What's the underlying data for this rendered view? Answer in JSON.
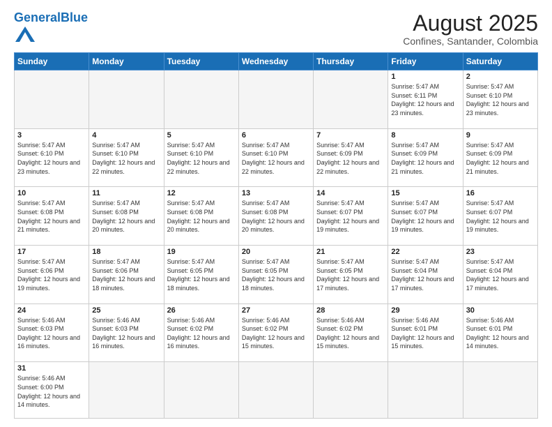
{
  "header": {
    "logo_general": "General",
    "logo_blue": "Blue",
    "month_title": "August 2025",
    "location": "Confines, Santander, Colombia"
  },
  "weekdays": [
    "Sunday",
    "Monday",
    "Tuesday",
    "Wednesday",
    "Thursday",
    "Friday",
    "Saturday"
  ],
  "weeks": [
    [
      {
        "day": "",
        "info": ""
      },
      {
        "day": "",
        "info": ""
      },
      {
        "day": "",
        "info": ""
      },
      {
        "day": "",
        "info": ""
      },
      {
        "day": "",
        "info": ""
      },
      {
        "day": "1",
        "info": "Sunrise: 5:47 AM\nSunset: 6:11 PM\nDaylight: 12 hours and 23 minutes."
      },
      {
        "day": "2",
        "info": "Sunrise: 5:47 AM\nSunset: 6:10 PM\nDaylight: 12 hours and 23 minutes."
      }
    ],
    [
      {
        "day": "3",
        "info": "Sunrise: 5:47 AM\nSunset: 6:10 PM\nDaylight: 12 hours and 23 minutes."
      },
      {
        "day": "4",
        "info": "Sunrise: 5:47 AM\nSunset: 6:10 PM\nDaylight: 12 hours and 22 minutes."
      },
      {
        "day": "5",
        "info": "Sunrise: 5:47 AM\nSunset: 6:10 PM\nDaylight: 12 hours and 22 minutes."
      },
      {
        "day": "6",
        "info": "Sunrise: 5:47 AM\nSunset: 6:10 PM\nDaylight: 12 hours and 22 minutes."
      },
      {
        "day": "7",
        "info": "Sunrise: 5:47 AM\nSunset: 6:09 PM\nDaylight: 12 hours and 22 minutes."
      },
      {
        "day": "8",
        "info": "Sunrise: 5:47 AM\nSunset: 6:09 PM\nDaylight: 12 hours and 21 minutes."
      },
      {
        "day": "9",
        "info": "Sunrise: 5:47 AM\nSunset: 6:09 PM\nDaylight: 12 hours and 21 minutes."
      }
    ],
    [
      {
        "day": "10",
        "info": "Sunrise: 5:47 AM\nSunset: 6:08 PM\nDaylight: 12 hours and 21 minutes."
      },
      {
        "day": "11",
        "info": "Sunrise: 5:47 AM\nSunset: 6:08 PM\nDaylight: 12 hours and 20 minutes."
      },
      {
        "day": "12",
        "info": "Sunrise: 5:47 AM\nSunset: 6:08 PM\nDaylight: 12 hours and 20 minutes."
      },
      {
        "day": "13",
        "info": "Sunrise: 5:47 AM\nSunset: 6:08 PM\nDaylight: 12 hours and 20 minutes."
      },
      {
        "day": "14",
        "info": "Sunrise: 5:47 AM\nSunset: 6:07 PM\nDaylight: 12 hours and 19 minutes."
      },
      {
        "day": "15",
        "info": "Sunrise: 5:47 AM\nSunset: 6:07 PM\nDaylight: 12 hours and 19 minutes."
      },
      {
        "day": "16",
        "info": "Sunrise: 5:47 AM\nSunset: 6:07 PM\nDaylight: 12 hours and 19 minutes."
      }
    ],
    [
      {
        "day": "17",
        "info": "Sunrise: 5:47 AM\nSunset: 6:06 PM\nDaylight: 12 hours and 19 minutes."
      },
      {
        "day": "18",
        "info": "Sunrise: 5:47 AM\nSunset: 6:06 PM\nDaylight: 12 hours and 18 minutes."
      },
      {
        "day": "19",
        "info": "Sunrise: 5:47 AM\nSunset: 6:05 PM\nDaylight: 12 hours and 18 minutes."
      },
      {
        "day": "20",
        "info": "Sunrise: 5:47 AM\nSunset: 6:05 PM\nDaylight: 12 hours and 18 minutes."
      },
      {
        "day": "21",
        "info": "Sunrise: 5:47 AM\nSunset: 6:05 PM\nDaylight: 12 hours and 17 minutes."
      },
      {
        "day": "22",
        "info": "Sunrise: 5:47 AM\nSunset: 6:04 PM\nDaylight: 12 hours and 17 minutes."
      },
      {
        "day": "23",
        "info": "Sunrise: 5:47 AM\nSunset: 6:04 PM\nDaylight: 12 hours and 17 minutes."
      }
    ],
    [
      {
        "day": "24",
        "info": "Sunrise: 5:46 AM\nSunset: 6:03 PM\nDaylight: 12 hours and 16 minutes."
      },
      {
        "day": "25",
        "info": "Sunrise: 5:46 AM\nSunset: 6:03 PM\nDaylight: 12 hours and 16 minutes."
      },
      {
        "day": "26",
        "info": "Sunrise: 5:46 AM\nSunset: 6:02 PM\nDaylight: 12 hours and 16 minutes."
      },
      {
        "day": "27",
        "info": "Sunrise: 5:46 AM\nSunset: 6:02 PM\nDaylight: 12 hours and 15 minutes."
      },
      {
        "day": "28",
        "info": "Sunrise: 5:46 AM\nSunset: 6:02 PM\nDaylight: 12 hours and 15 minutes."
      },
      {
        "day": "29",
        "info": "Sunrise: 5:46 AM\nSunset: 6:01 PM\nDaylight: 12 hours and 15 minutes."
      },
      {
        "day": "30",
        "info": "Sunrise: 5:46 AM\nSunset: 6:01 PM\nDaylight: 12 hours and 14 minutes."
      }
    ],
    [
      {
        "day": "31",
        "info": "Sunrise: 5:46 AM\nSunset: 6:00 PM\nDaylight: 12 hours and 14 minutes."
      },
      {
        "day": "",
        "info": ""
      },
      {
        "day": "",
        "info": ""
      },
      {
        "day": "",
        "info": ""
      },
      {
        "day": "",
        "info": ""
      },
      {
        "day": "",
        "info": ""
      },
      {
        "day": "",
        "info": ""
      }
    ]
  ]
}
